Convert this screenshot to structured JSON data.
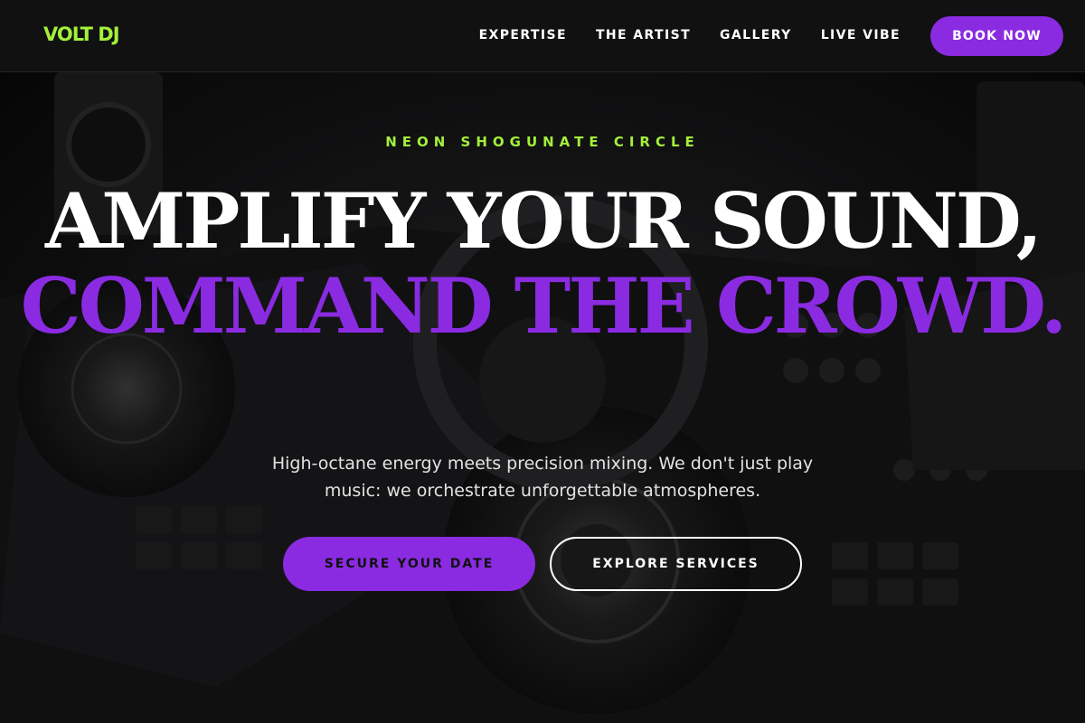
{
  "brand": {
    "logo": "VOLT DJ",
    "accent_green": "#a3f03a",
    "accent_purple": "#8a2be2"
  },
  "nav": {
    "items": [
      {
        "label": "EXPERTISE"
      },
      {
        "label": "THE ARTIST"
      },
      {
        "label": "GALLERY"
      },
      {
        "label": "LIVE VIBE"
      }
    ],
    "cta_label": "BOOK NOW"
  },
  "hero": {
    "background_description_icon": "dj-controller-photo",
    "eyebrow": "NEON SHOGUNATE CIRCLE",
    "headline_line1": "AMPLIFY YOUR SOUND,",
    "headline_line2": "COMMAND THE CROWD.",
    "subtitle": "High-octane energy meets precision mixing. We don't just play music: we orchestrate unforgettable atmospheres.",
    "primary_cta": "SECURE YOUR DATE",
    "secondary_cta": "EXPLORE SERVICES"
  }
}
